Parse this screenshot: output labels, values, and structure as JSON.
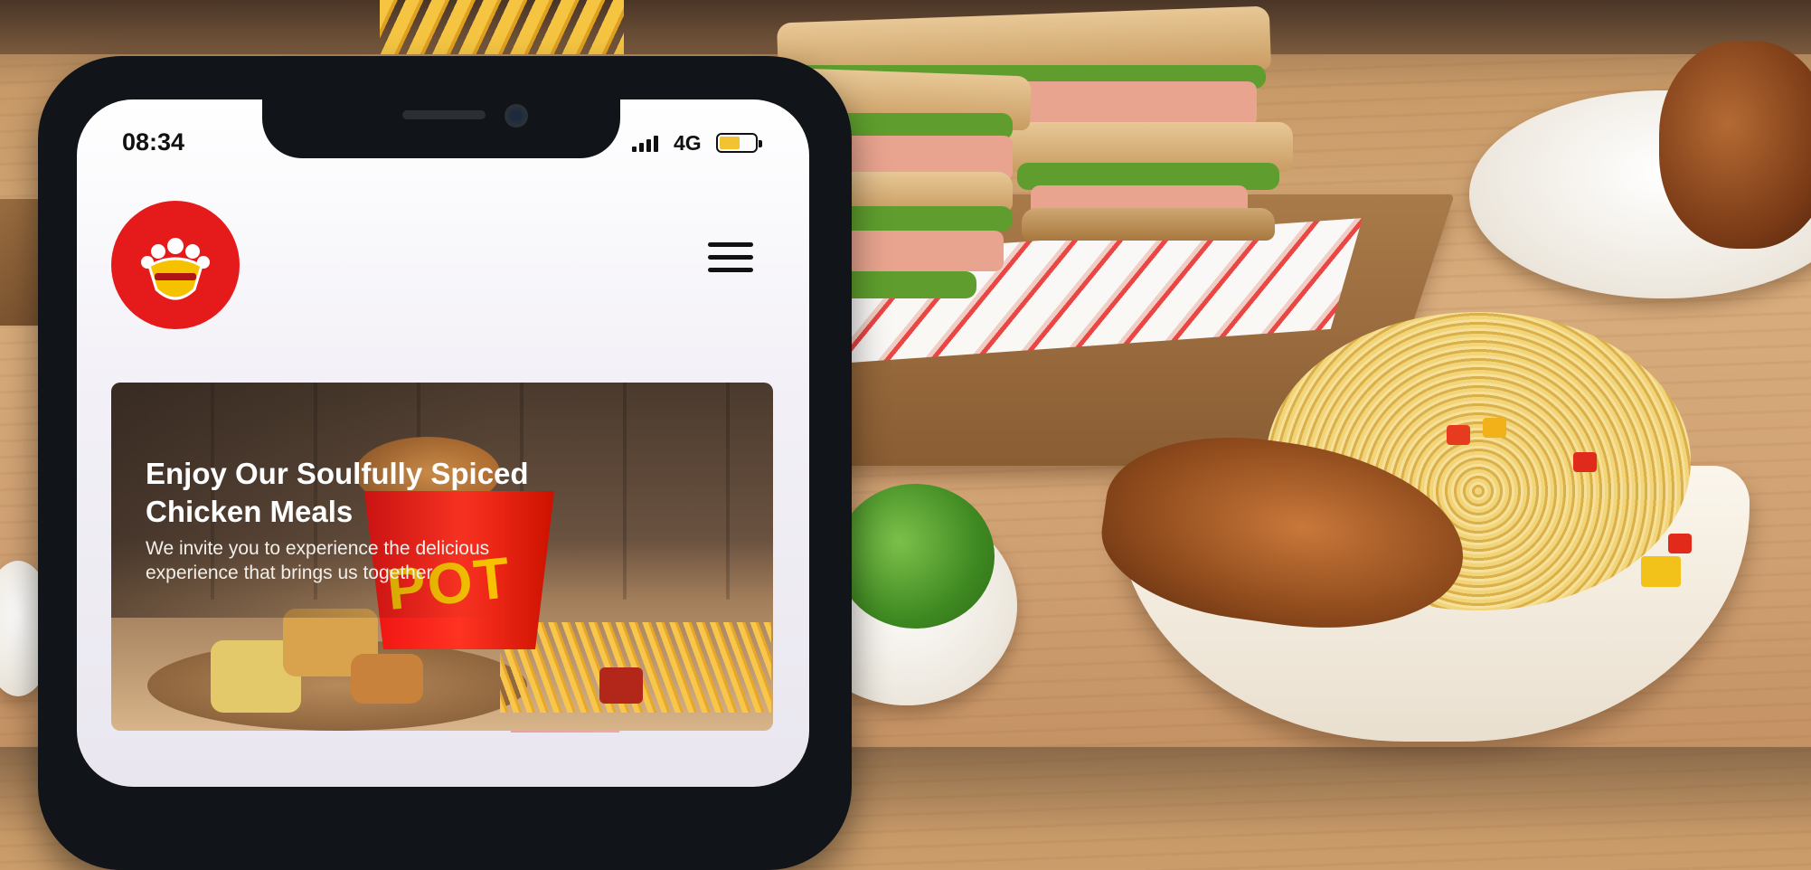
{
  "status_bar": {
    "time": "08:34",
    "network": "4G",
    "battery_level": 0.52
  },
  "header": {
    "logo_icon": "chicken-crown-logo-icon",
    "menu_icon": "hamburger-menu-icon"
  },
  "hero": {
    "title": "Enjoy Our Soulfully Spiced Chicken Meals",
    "text": "We invite you to experience the delicious experience that brings us together",
    "bucket_label": "POT"
  },
  "colors": {
    "brand_red": "#e51b1b",
    "battery_yellow": "#f1c232",
    "phone_frame": "#111418"
  }
}
